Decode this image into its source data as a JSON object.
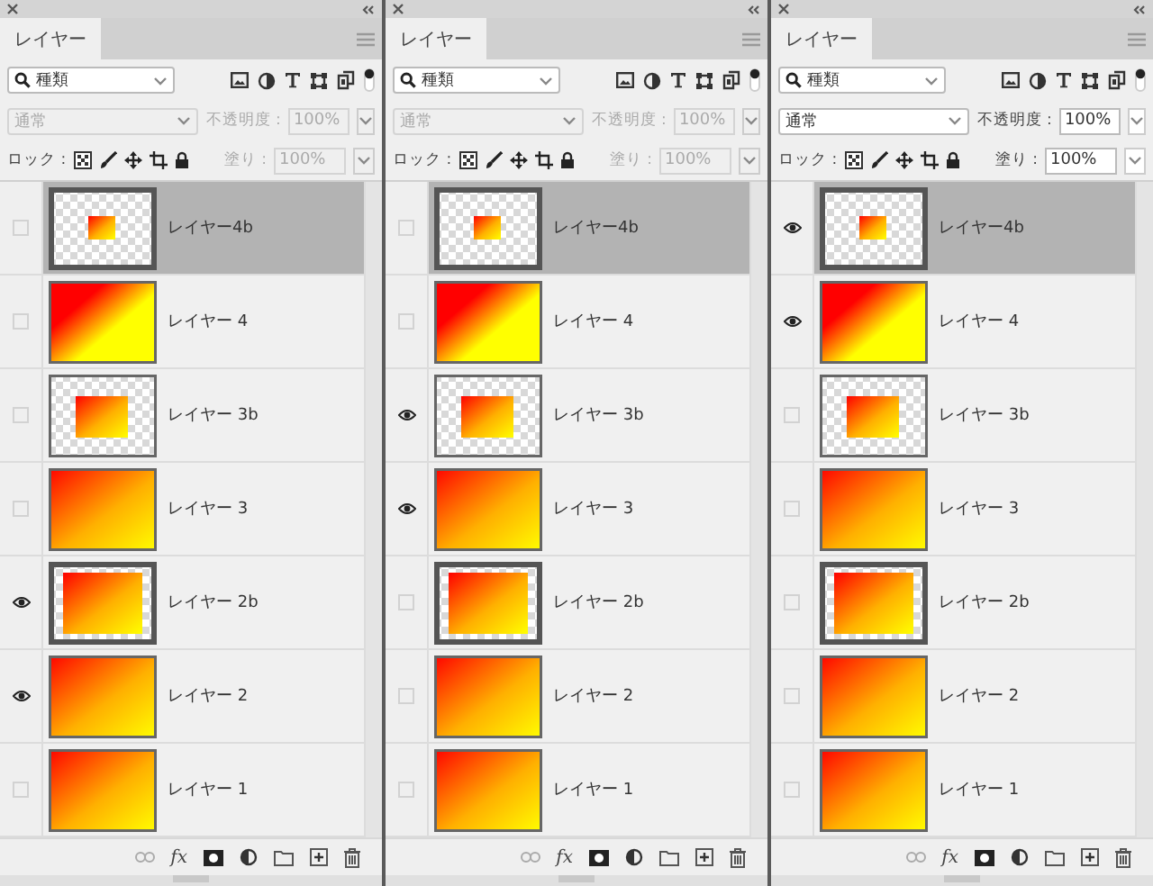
{
  "panels": [
    {
      "tab": "レイヤー",
      "filter": "種類",
      "blend": "通常",
      "opacity_label": "不透明度 :",
      "opacity": "100%",
      "lock_label": "ロック :",
      "fill_label": "塗り :",
      "fill": "100%",
      "disabled": true,
      "fx": "fx",
      "layers": [
        {
          "name": "レイヤー4b",
          "kind": "small",
          "framed": true,
          "selected": true,
          "visible": false
        },
        {
          "name": "レイヤー 4",
          "kind": "diagonal",
          "framed": false,
          "selected": false,
          "visible": false
        },
        {
          "name": "レイヤー 3b",
          "kind": "medium",
          "framed": false,
          "selected": false,
          "visible": false
        },
        {
          "name": "レイヤー 3",
          "kind": "gradient",
          "framed": false,
          "selected": false,
          "visible": false
        },
        {
          "name": "レイヤー 2b",
          "kind": "large",
          "framed": true,
          "selected": false,
          "visible": true
        },
        {
          "name": "レイヤー 2",
          "kind": "gradient",
          "framed": false,
          "selected": false,
          "visible": true
        },
        {
          "name": "レイヤー 1",
          "kind": "gradient",
          "framed": false,
          "selected": false,
          "visible": false
        }
      ]
    },
    {
      "tab": "レイヤー",
      "filter": "種類",
      "blend": "通常",
      "opacity_label": "不透明度 :",
      "opacity": "100%",
      "lock_label": "ロック :",
      "fill_label": "塗り :",
      "fill": "100%",
      "disabled": true,
      "fx": "fx",
      "layers": [
        {
          "name": "レイヤー4b",
          "kind": "small",
          "framed": true,
          "selected": true,
          "visible": false
        },
        {
          "name": "レイヤー 4",
          "kind": "diagonal",
          "framed": false,
          "selected": false,
          "visible": false
        },
        {
          "name": "レイヤー 3b",
          "kind": "medium",
          "framed": false,
          "selected": false,
          "visible": true
        },
        {
          "name": "レイヤー 3",
          "kind": "gradient",
          "framed": false,
          "selected": false,
          "visible": true
        },
        {
          "name": "レイヤー 2b",
          "kind": "large",
          "framed": true,
          "selected": false,
          "visible": false
        },
        {
          "name": "レイヤー 2",
          "kind": "gradient",
          "framed": false,
          "selected": false,
          "visible": false
        },
        {
          "name": "レイヤー 1",
          "kind": "gradient",
          "framed": false,
          "selected": false,
          "visible": false
        }
      ]
    },
    {
      "tab": "レイヤー",
      "filter": "種類",
      "blend": "通常",
      "opacity_label": "不透明度 :",
      "opacity": "100%",
      "lock_label": "ロック :",
      "fill_label": "塗り :",
      "fill": "100%",
      "disabled": false,
      "fx": "fx",
      "layers": [
        {
          "name": "レイヤー4b",
          "kind": "small",
          "framed": true,
          "selected": true,
          "visible": true
        },
        {
          "name": "レイヤー 4",
          "kind": "diagonal",
          "framed": false,
          "selected": false,
          "visible": true
        },
        {
          "name": "レイヤー 3b",
          "kind": "medium",
          "framed": false,
          "selected": false,
          "visible": false
        },
        {
          "name": "レイヤー 3",
          "kind": "gradient",
          "framed": false,
          "selected": false,
          "visible": false
        },
        {
          "name": "レイヤー 2b",
          "kind": "large",
          "framed": true,
          "selected": false,
          "visible": false
        },
        {
          "name": "レイヤー 2",
          "kind": "gradient",
          "framed": false,
          "selected": false,
          "visible": false
        },
        {
          "name": "レイヤー 1",
          "kind": "gradient",
          "framed": false,
          "selected": false,
          "visible": false
        }
      ]
    }
  ]
}
